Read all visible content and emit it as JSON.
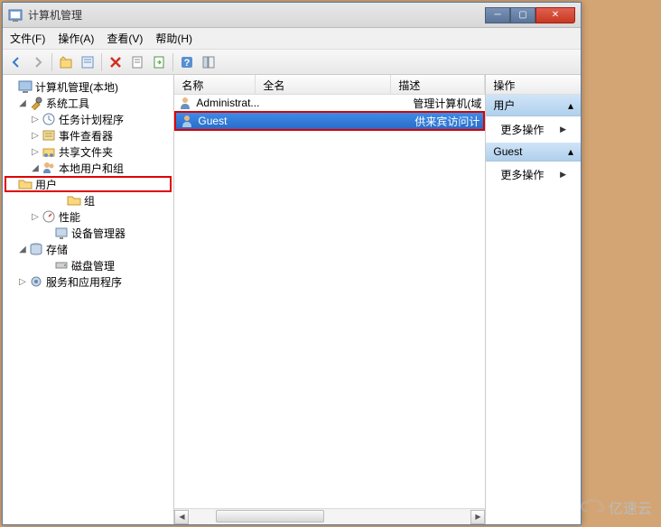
{
  "window": {
    "title": "计算机管理"
  },
  "menu": {
    "file": "文件(F)",
    "action": "操作(A)",
    "view": "查看(V)",
    "help": "帮助(H)"
  },
  "tree": {
    "root": "计算机管理(本地)",
    "sys_tools": "系统工具",
    "task_sched": "任务计划程序",
    "event_viewer": "事件查看器",
    "shared_folders": "共享文件夹",
    "local_users": "本地用户和组",
    "users": "用户",
    "groups": "组",
    "performance": "性能",
    "device_mgr": "设备管理器",
    "storage": "存储",
    "disk_mgmt": "磁盘管理",
    "services": "服务和应用程序"
  },
  "list": {
    "col_name": "名称",
    "col_full": "全名",
    "col_desc": "描述",
    "rows": [
      {
        "name": "Administrat...",
        "full": "",
        "desc": "管理计算机(域"
      },
      {
        "name": "Guest",
        "full": "",
        "desc": "供来宾访问计"
      }
    ]
  },
  "actions": {
    "header": "操作",
    "group1": "用户",
    "more1": "更多操作",
    "group2": "Guest",
    "more2": "更多操作"
  },
  "watermark": "亿速云"
}
